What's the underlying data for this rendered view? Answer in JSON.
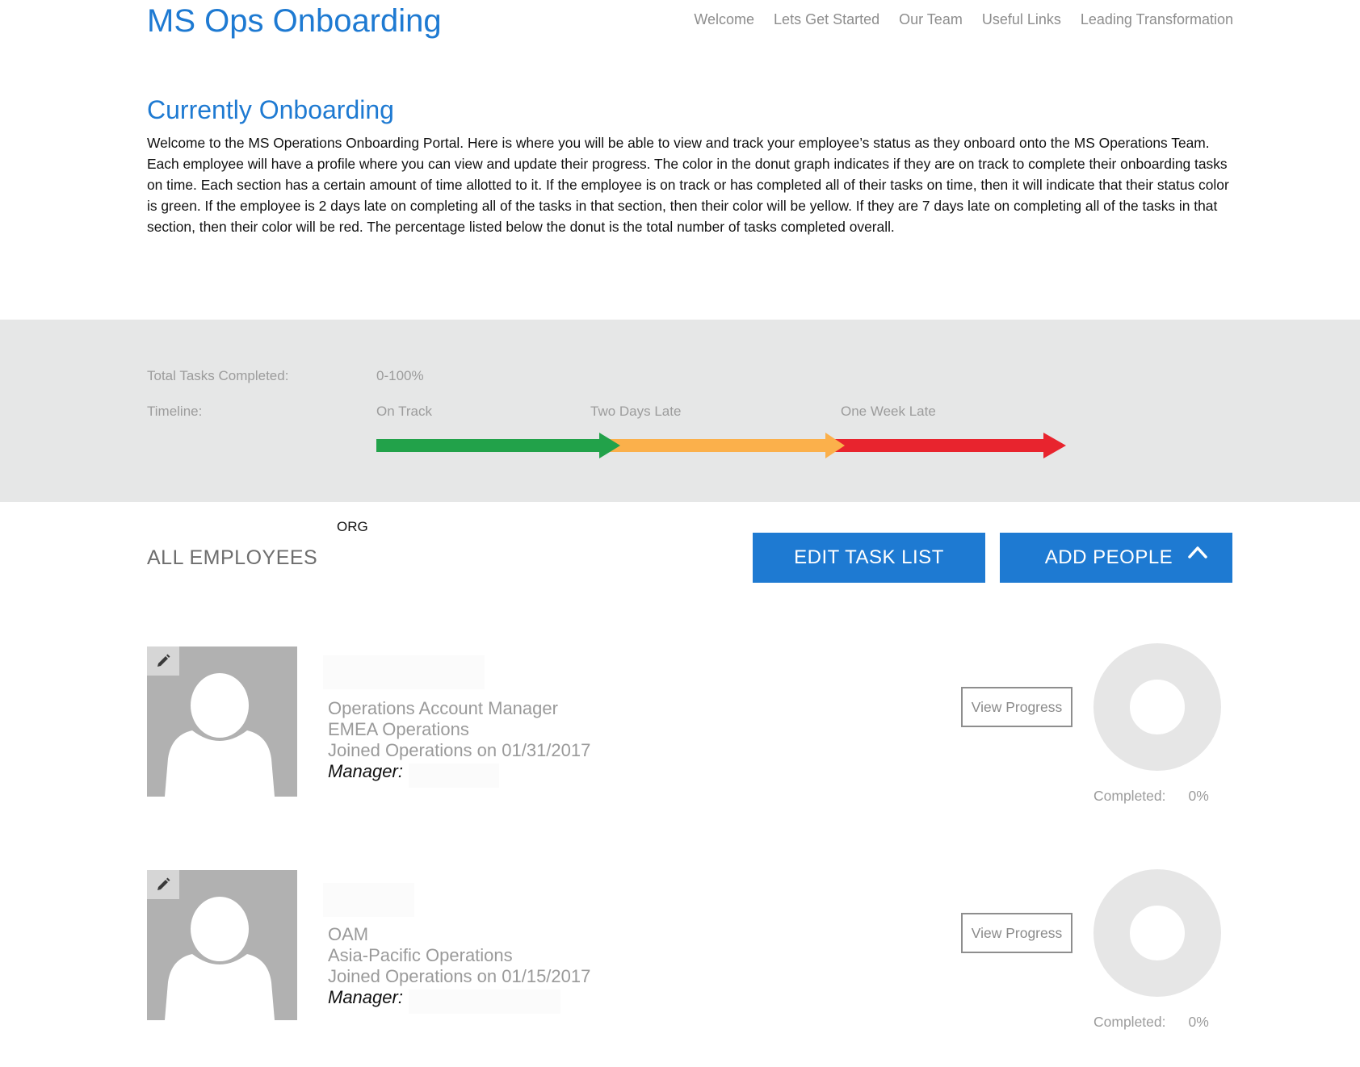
{
  "header": {
    "title": "MS Ops Onboarding",
    "nav": [
      "Welcome",
      "Lets Get Started",
      "Our Team",
      "Useful Links",
      "Leading Transformation"
    ]
  },
  "intro": {
    "heading": "Currently Onboarding",
    "body": "Welcome to the MS Operations Onboarding Portal. Here is where you will be able to view and track your employee’s status as they onboard onto the MS Operations Team. Each employee will have a profile where you can view and update their progress. The color in the donut graph indicates if they are on track to complete their onboarding tasks on time. Each section has a certain amount of time allotted to it. If the employee is on track or has completed all of their tasks on time, then it will indicate that their status color is green. If the employee is 2 days late on completing all of the tasks in that section, then their color will be yellow. If they are 7 days late on completing all of the tasks in that section, then their color will be red. The percentage listed below the donut is the total number of tasks completed overall."
  },
  "legend": {
    "total_label": "Total Tasks Completed:",
    "total_value": "0-100%",
    "timeline_label": "Timeline:",
    "stages": [
      {
        "label": "On Track",
        "color": "#22a24a"
      },
      {
        "label": "Two Days Late",
        "color": "#fbb04b"
      },
      {
        "label": "One Week Late",
        "color": "#e8242e"
      }
    ]
  },
  "employees_section": {
    "org_label": "ORG",
    "heading": "ALL EMPLOYEES",
    "edit_button": "EDIT TASK LIST",
    "add_button": "ADD PEOPLE"
  },
  "employees": [
    {
      "title": "Operations Account Manager",
      "org": "EMEA Operations",
      "joined": "Joined Operations on 01/31/2017",
      "manager_label": "Manager:",
      "view_button": "View Progress",
      "completed_label": "Completed:",
      "completed_value": "0%"
    },
    {
      "title": "OAM",
      "org": "Asia-Pacific Operations",
      "joined": "Joined Operations on 01/15/2017",
      "manager_label": "Manager:",
      "view_button": "View Progress",
      "completed_label": "Completed:",
      "completed_value": "0%"
    }
  ],
  "colors": {
    "accent": "#1e7ad2",
    "band": "#e6e7e7",
    "donut": "#e6e6e6"
  }
}
